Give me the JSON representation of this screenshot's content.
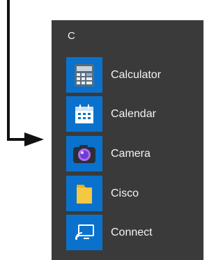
{
  "start_menu": {
    "group_letter": "C",
    "apps": [
      {
        "label": "Calculator",
        "icon": "calculator-icon"
      },
      {
        "label": "Calendar",
        "icon": "calendar-icon"
      },
      {
        "label": "Camera",
        "icon": "camera-icon"
      },
      {
        "label": "Cisco",
        "icon": "folder-icon"
      },
      {
        "label": "Connect",
        "icon": "connect-icon"
      }
    ]
  },
  "colors": {
    "panel_background": "#3a3a3a",
    "tile_background": "#0a72cc",
    "text": "#f4f4f4",
    "arrow": "#111111"
  }
}
